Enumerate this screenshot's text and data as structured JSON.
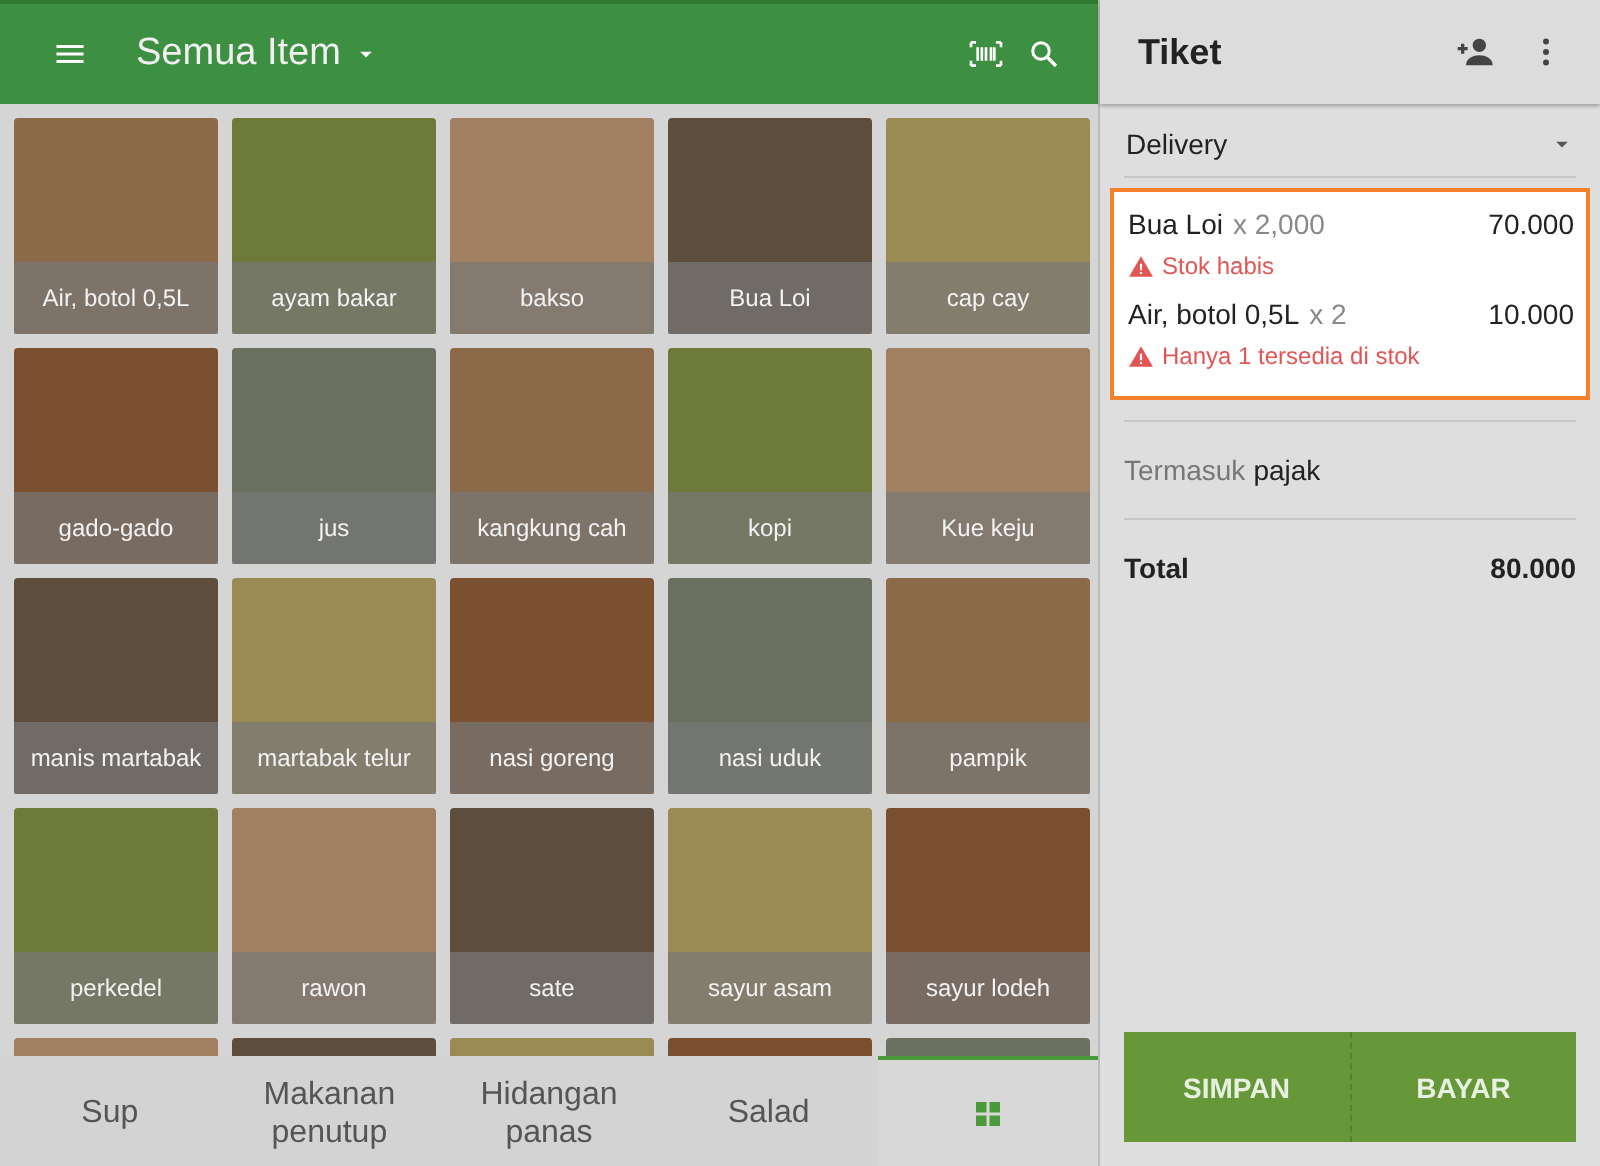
{
  "header": {
    "title": "Semua Item"
  },
  "items": [
    {
      "label": "Air, botol 0,5L"
    },
    {
      "label": "ayam bakar"
    },
    {
      "label": "bakso"
    },
    {
      "label": "Bua Loi"
    },
    {
      "label": "cap cay"
    },
    {
      "label": "gado-gado"
    },
    {
      "label": "jus"
    },
    {
      "label": "kangkung cah"
    },
    {
      "label": "kopi"
    },
    {
      "label": "Kue keju"
    },
    {
      "label": "manis martabak"
    },
    {
      "label": "martabak telur"
    },
    {
      "label": "nasi goreng"
    },
    {
      "label": "nasi uduk"
    },
    {
      "label": "pampik"
    },
    {
      "label": "perkedel"
    },
    {
      "label": "rawon"
    },
    {
      "label": "sate"
    },
    {
      "label": "sayur asam"
    },
    {
      "label": "sayur lodeh"
    }
  ],
  "categories": [
    {
      "label": "Sup",
      "kind": "text",
      "selected": false
    },
    {
      "label": "Makanan penutup",
      "kind": "text",
      "selected": false
    },
    {
      "label": "Hidangan panas",
      "kind": "text",
      "selected": false
    },
    {
      "label": "Salad",
      "kind": "text",
      "selected": false
    },
    {
      "kind": "grid",
      "selected": true
    }
  ],
  "ticket": {
    "title": "Tiket",
    "order_type": "Delivery",
    "lines": [
      {
        "name": "Bua Loi",
        "qty": "x 2,000",
        "amount": "70.000",
        "warning": "Stok habis"
      },
      {
        "name": "Air, botol 0,5L",
        "qty": "x 2",
        "amount": "10.000",
        "warning": "Hanya 1 tersedia di stok"
      }
    ],
    "tax_label": "Termasuk",
    "tax_value": "pajak",
    "total_label": "Total",
    "total": "80.000"
  },
  "buttons": [
    "SIMPAN",
    "BAYAR"
  ]
}
